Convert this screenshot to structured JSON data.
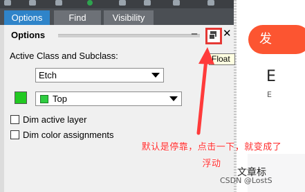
{
  "tabs": [
    {
      "label": "Options",
      "active": true
    },
    {
      "label": "Find",
      "active": false
    },
    {
      "label": "Visibility",
      "active": false
    }
  ],
  "panel": {
    "title": "Options",
    "minimize_glyph": "–",
    "close_glyph": "✕",
    "active_class_label": "Active Class and Subclass:",
    "class_value": "Etch",
    "subclass_value": "Top",
    "subclass_color": "#2ecc40",
    "swatch_color": "#22c922",
    "dim_active_layer": "Dim active layer",
    "dim_color_assignments": "Dim color assignments"
  },
  "tooltip": {
    "text": "Float"
  },
  "annotation": {
    "line1": "默认是停靠，点击一下，就变成了",
    "line2": "浮动",
    "color": "#ff2b2b"
  },
  "web": {
    "button_label": "发",
    "big_text": "E",
    "small_text": "E",
    "article_title": "文章标",
    "watermark": "CSDN @LostS"
  },
  "icons": {
    "float": "float-window-icon",
    "close": "close-icon",
    "minimize": "minimize-icon",
    "dropdown": "chevron-down-icon"
  }
}
